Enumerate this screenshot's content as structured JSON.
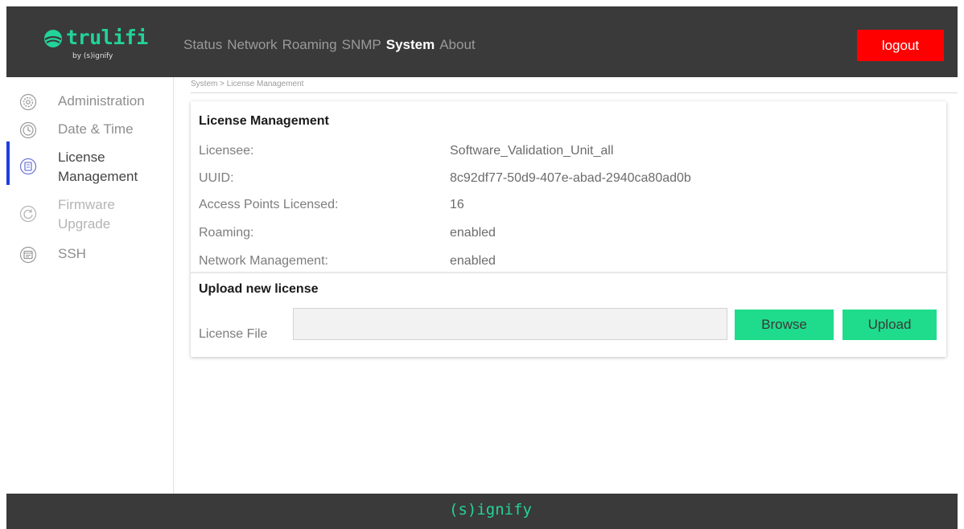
{
  "brand": {
    "name": "trulifi",
    "byline": "by (s)ignify"
  },
  "nav": {
    "items": [
      {
        "label": "Status"
      },
      {
        "label": "Network"
      },
      {
        "label": "Roaming"
      },
      {
        "label": "SNMP"
      },
      {
        "label": "System"
      },
      {
        "label": "About"
      }
    ],
    "active": "System",
    "logout_label": "logout"
  },
  "sidebar": {
    "items": [
      {
        "label": "Administration",
        "icon": "settings-icon"
      },
      {
        "label": "Date & Time",
        "icon": "clock-icon"
      },
      {
        "label": "License\nManagement",
        "icon": "license-icon"
      },
      {
        "label": "Firmware\nUpgrade",
        "icon": "refresh-icon"
      },
      {
        "label": "SSH",
        "icon": "terminal-icon"
      }
    ],
    "active_index": 2
  },
  "breadcrumb": "System > License Management",
  "license": {
    "title": "License Management",
    "rows": [
      {
        "label": "Licensee:",
        "value": "Software_Validation_Unit_all"
      },
      {
        "label": "UUID:",
        "value": "8c92df77-50d9-407e-abad-2940ca80ad0b"
      },
      {
        "label": "Access Points Licensed:",
        "value": "16"
      },
      {
        "label": "Roaming:",
        "value": "enabled"
      },
      {
        "label": "Network Management:",
        "value": "enabled"
      }
    ]
  },
  "upload": {
    "title": "Upload new license",
    "file_label": "License File",
    "file_value": "",
    "browse_label": "Browse",
    "upload_label": "Upload"
  },
  "footer": {
    "brand": "(s)ignify"
  },
  "colors": {
    "header_bg": "#3a3a3a",
    "brand_green": "#22d39a",
    "button_green": "#1fdc8c",
    "logout_red": "#ff0000",
    "active_indicator": "#1b3fe0"
  }
}
